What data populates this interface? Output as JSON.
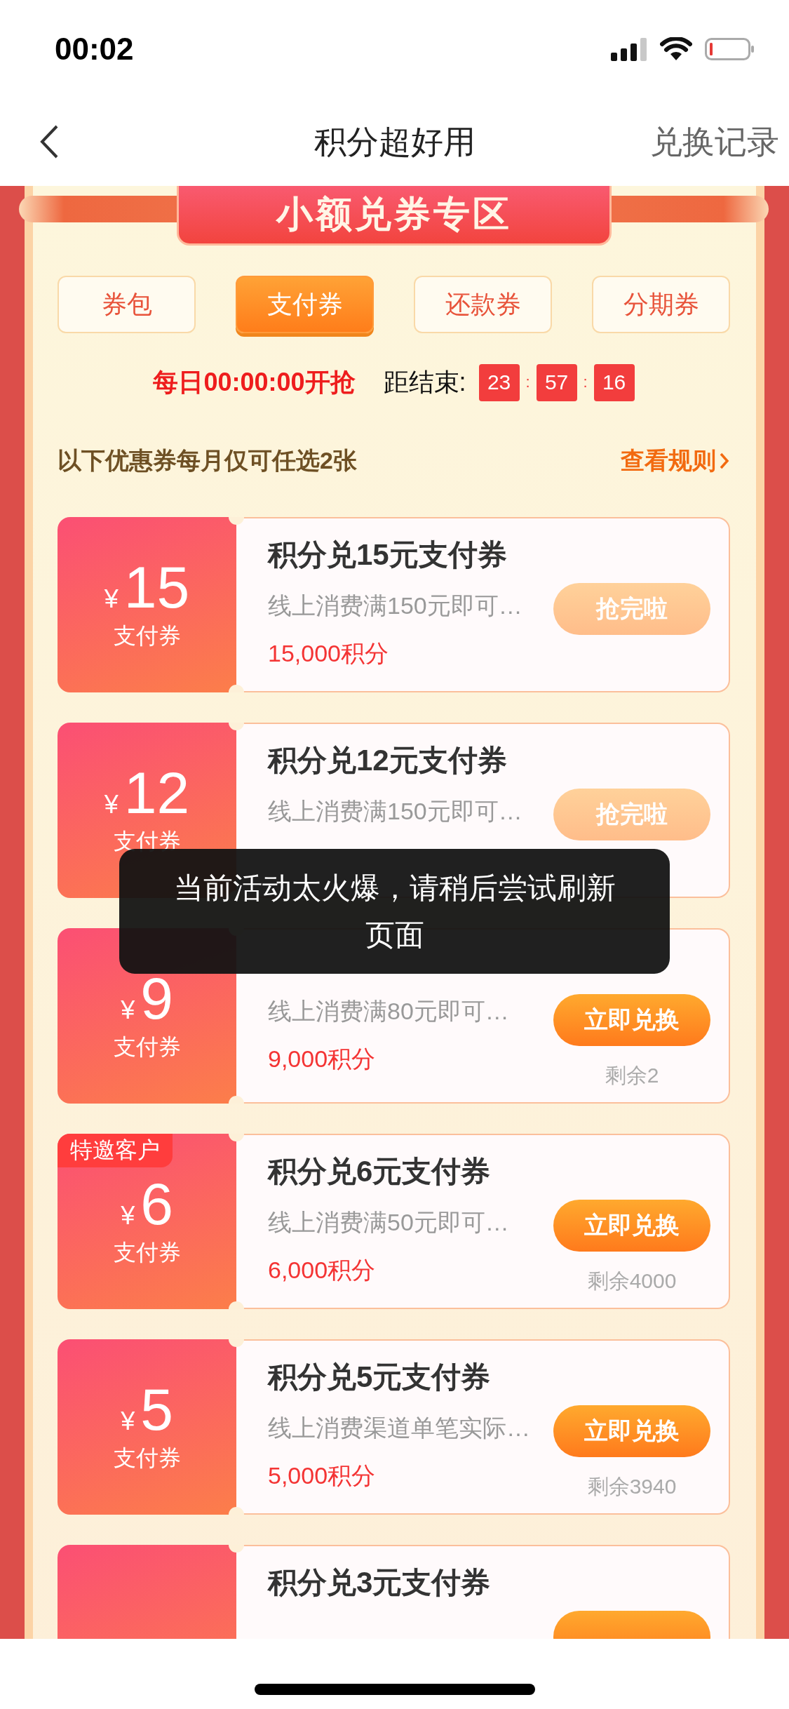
{
  "status_bar": {
    "time": "00:02"
  },
  "nav": {
    "title": "积分超好用",
    "action": "兑换记录"
  },
  "banner": {
    "title": "小额兑券专区"
  },
  "tabs": [
    {
      "label": "券包",
      "selected": false
    },
    {
      "label": "支付券",
      "selected": true
    },
    {
      "label": "还款券",
      "selected": false
    },
    {
      "label": "分期券",
      "selected": false
    }
  ],
  "timer": {
    "start_text": "每日00:00:00开抢",
    "end_label": "距结束:",
    "parts": [
      {
        "kind": "digit",
        "text": "23"
      },
      {
        "kind": "sep",
        "text": ":"
      },
      {
        "kind": "digit",
        "text": "57"
      },
      {
        "kind": "sep",
        "text": ":"
      },
      {
        "kind": "digit",
        "text": "16"
      }
    ]
  },
  "notice": {
    "text": "以下优惠券每月仅可任选**2**张",
    "link": "查看规则"
  },
  "coupons": [
    {
      "currency": "¥",
      "amount": "15",
      "type_label": "支付券",
      "title": "积分兑**15**元支付券",
      "description": "线上消费满150元即可…",
      "points": "15,000积分",
      "button": "抢完啦",
      "sold_out": true
    },
    {
      "currency": "¥",
      "amount": "12",
      "type_label": "支付券",
      "title": "积分兑**12**元支付券",
      "description": "线上消费满150元即可…",
      "button": "抢完啦",
      "sold_out": true
    },
    {
      "currency": "¥",
      "amount": "9",
      "type_label": "支付券",
      "description": "线上消费满80元即可…",
      "points": "9,000积分",
      "button": "立即兑换",
      "sold_out": false,
      "remaining": "剩余2"
    },
    {
      "badge": "特邀客户",
      "currency": "¥",
      "amount": "6",
      "type_label": "支付券",
      "title": "积分兑**6**元支付券",
      "description": "线上消费满50元即可…",
      "points": "6,000积分",
      "button": "立即兑换",
      "sold_out": false,
      "remaining": "剩余4000"
    },
    {
      "currency": "¥",
      "amount": "5",
      "type_label": "支付券",
      "title": "积分兑**5**元支付券",
      "description": "线上消费渠道单笔实际…",
      "points": "5,000积分",
      "button": "立即兑换",
      "sold_out": false,
      "remaining": "剩余3940"
    },
    {
      "title": "积分兑**3**元支付券",
      "sold_out": false
    }
  ],
  "toast": {
    "message": "当前活动太火爆，请稍后尝试刷新页面"
  }
}
